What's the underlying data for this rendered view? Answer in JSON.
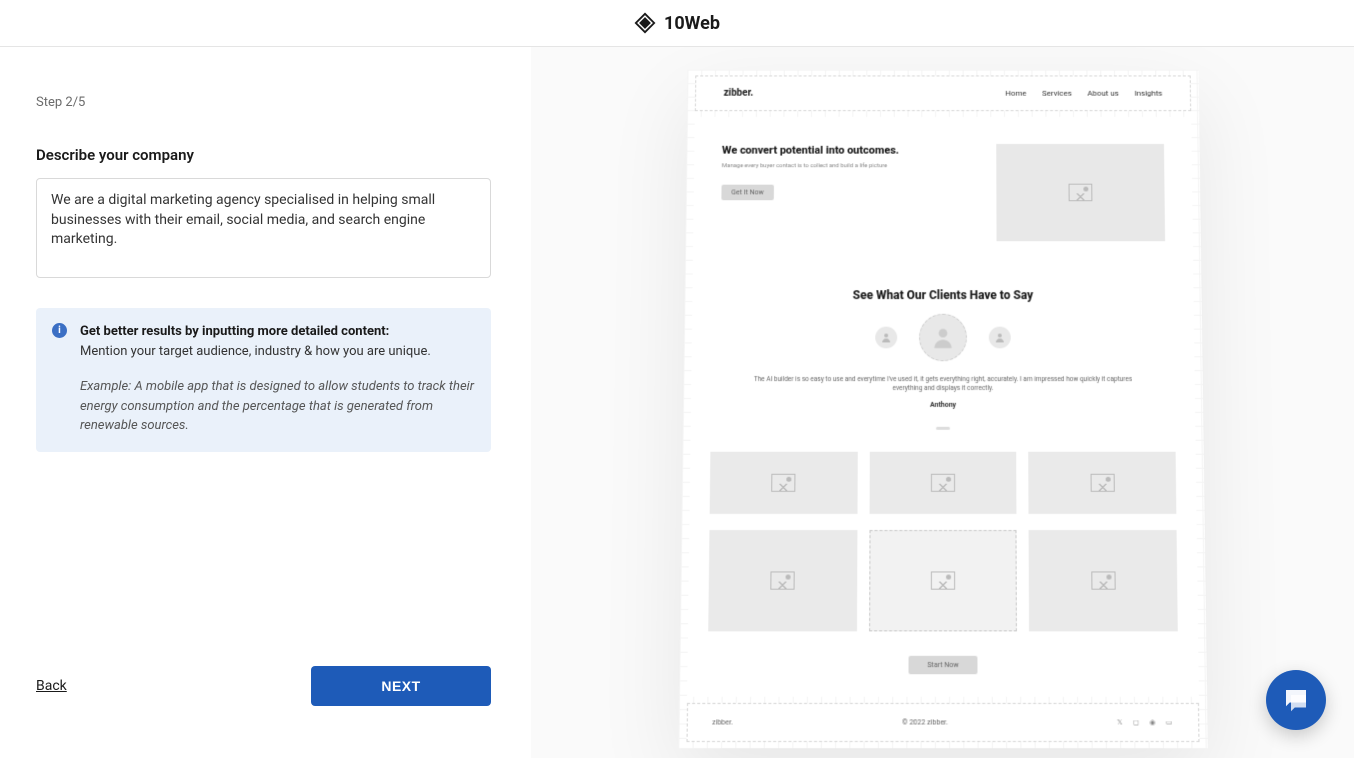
{
  "header": {
    "brand": "10Web"
  },
  "step": {
    "label": "Step 2/5"
  },
  "form": {
    "label": "Describe your company",
    "value": "We are a digital marketing agency specialised in helping small businesses with their email, social media, and search engine marketing."
  },
  "tip": {
    "title": "Get better results by inputting more detailed content:",
    "line": "Mention your target audience, industry & how you are unique.",
    "example": "Example: A mobile app that is designed to allow students to track their energy consumption and the percentage that is generated from renewable sources."
  },
  "actions": {
    "back": "Back",
    "next": "NEXT"
  },
  "preview": {
    "brand": "zibber.",
    "nav": [
      "Home",
      "Services",
      "About us",
      "Insights"
    ],
    "hero_title": "We convert potential into outcomes.",
    "hero_sub": "Manage every buyer contact is to collect and build a life picture",
    "hero_cta": "Get It Now",
    "section_title": "See What Our Clients Have to Say",
    "testimonial": "The AI builder is so easy to use and everytime I've used it, it gets everything right, accurately. I am impressed how quickly it captures everything and displays it correctly.",
    "testimonial_name": "Anthony",
    "start_cta": "Start Now",
    "footer_brand": "zibber.",
    "footer_copy": "© 2022 zibber."
  }
}
